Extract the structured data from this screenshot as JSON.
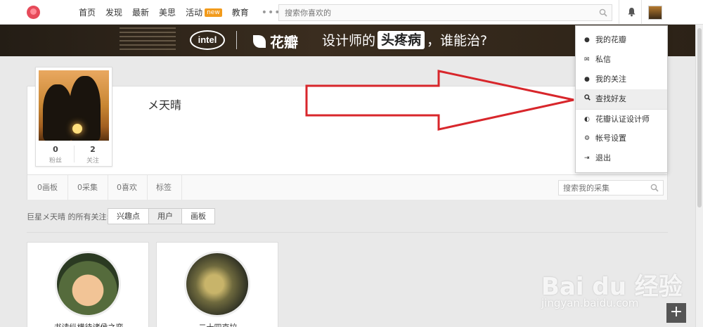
{
  "nav": {
    "items": [
      {
        "label": "首页"
      },
      {
        "label": "发现"
      },
      {
        "label": "最新"
      },
      {
        "label": "美思"
      },
      {
        "label": "活动",
        "badge": "new"
      },
      {
        "label": "教育"
      }
    ],
    "more": "•••",
    "search_placeholder": "搜索你喜欢的"
  },
  "banner": {
    "intel": "intel",
    "brand": "花瓣",
    "slogan_prefix": "设计师的",
    "slogan_highlight": "头疼病",
    "slogan_suffix": "，谁能治?"
  },
  "profile": {
    "username": "メ天晴",
    "fans_count": "0",
    "fans_label": "粉丝",
    "following_count": "2",
    "following_label": "关注",
    "tabs": [
      "0画板",
      "0采集",
      "0喜欢",
      "标签"
    ],
    "search_placeholder": "搜索我的采集"
  },
  "following": {
    "label": "巨星メ天晴 的所有关注:",
    "filters": [
      "兴趣点",
      "用户",
      "画板"
    ],
    "active_filter": "用户",
    "users": [
      {
        "name": "书读纵横待诸侯之弈"
      },
      {
        "name": "二十四克拉"
      }
    ]
  },
  "dropdown": {
    "items": [
      {
        "label": "我的花瓣",
        "icon": "user-icon"
      },
      {
        "label": "私信",
        "icon": "mail-icon"
      },
      {
        "label": "我的关注",
        "icon": "users-icon"
      },
      {
        "label": "查找好友",
        "icon": "search-icon",
        "hover": true
      },
      {
        "label": "花瓣认证设计师",
        "icon": "badge-icon"
      },
      {
        "label": "帐号设置",
        "icon": "gear-icon"
      },
      {
        "label": "退出",
        "icon": "logout-icon"
      }
    ]
  },
  "watermark": {
    "brand": "Bai du 经验",
    "url": "jingyan.baidu.com"
  },
  "colors": {
    "brand_red": "#e64a5a",
    "arrow_red": "#d8262b",
    "new_badge": "#f29b1c"
  }
}
